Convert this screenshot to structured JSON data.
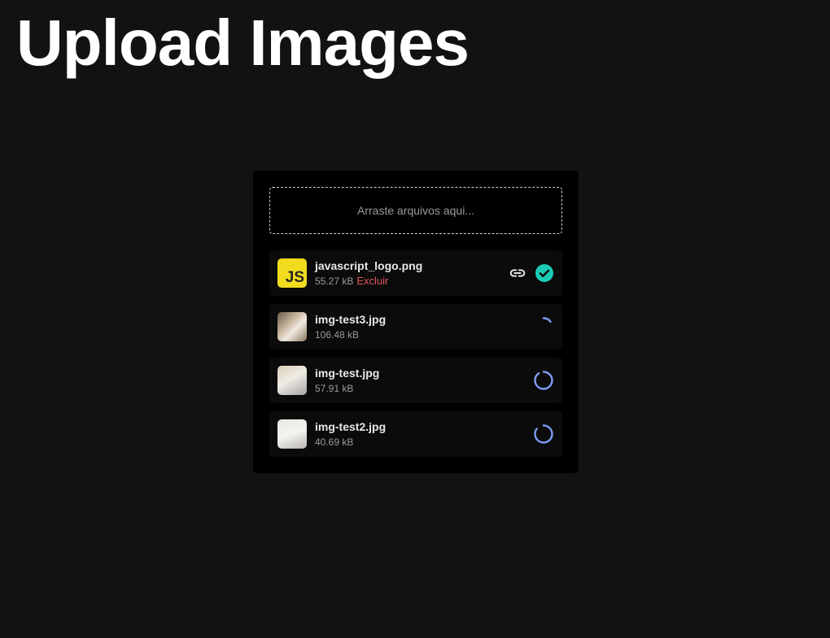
{
  "page": {
    "title": "Upload Images"
  },
  "dropzone": {
    "label": "Arraste arquivos aqui..."
  },
  "files": [
    {
      "name": "javascript_logo.png",
      "size": "55.27 kB",
      "delete_label": "Excluir",
      "thumb_text": "JS",
      "status": "uploaded"
    },
    {
      "name": "img-test3.jpg",
      "size": "106.48 kB",
      "status": "uploading",
      "progress": 0.15
    },
    {
      "name": "img-test.jpg",
      "size": "57.91 kB",
      "status": "uploading",
      "progress": 0.9
    },
    {
      "name": "img-test2.jpg",
      "size": "40.69 kB",
      "status": "uploading",
      "progress": 0.85
    }
  ],
  "icons": {
    "link": "link-icon",
    "done": "check-circle-icon",
    "progress": "progress-ring-icon"
  },
  "colors": {
    "success": "#19cbb5",
    "progress": "#7f9cf5",
    "delete": "#e0575f"
  }
}
